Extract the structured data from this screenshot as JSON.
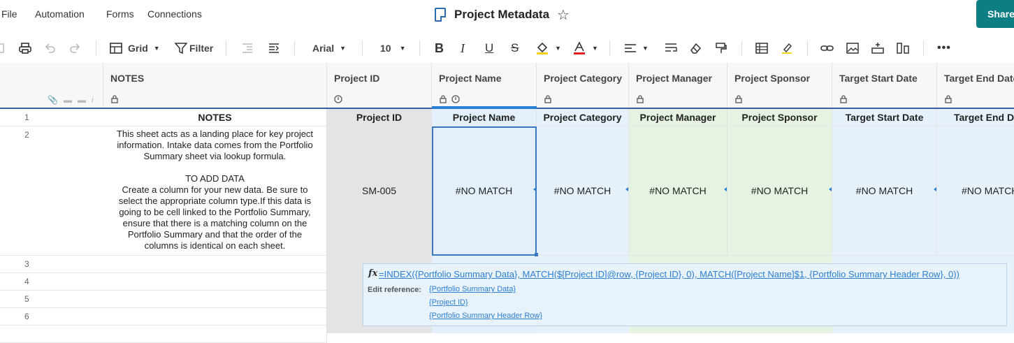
{
  "menu": {
    "items": [
      "File",
      "Automation",
      "Forms",
      "Connections"
    ],
    "title": "Project Metadata",
    "share_label": "Share"
  },
  "toolbar": {
    "view_label": "Grid",
    "filter_label": "Filter",
    "font_name": "Arial",
    "font_size": "10"
  },
  "columns": {
    "notes": "NOTES",
    "project_id": "Project ID",
    "project_name": "Project Name",
    "project_category": "Project Category",
    "project_manager": "Project Manager",
    "project_sponsor": "Project Sponsor",
    "target_start": "Target Start Date",
    "target_end": "Target End Date"
  },
  "rows": {
    "numbers": [
      "1",
      "2",
      "3",
      "4",
      "5",
      "6"
    ],
    "row1": {
      "notes": "NOTES",
      "project_id": "Project ID",
      "project_name": "Project Name",
      "project_category": "Project Category",
      "project_manager": "Project Manager",
      "project_sponsor": "Project Sponsor",
      "target_start": "Target Start Date",
      "target_end": "Target End Da"
    },
    "row2": {
      "notes": "This sheet acts as a landing place for key project information. Intake data comes from the Portfolio Summary sheet via lookup formula.\n\nTO ADD DATA\nCreate a column for your new data. Be sure to select the appropriate column type.If this data is going to be cell linked to the Portfolio Summary, ensure that there is a matching column on the Portfolio Summary and that the order of the columns is identical on each sheet.",
      "project_id": "SM-005",
      "project_name": "#NO MATCH",
      "project_category": "#NO MATCH",
      "project_manager": "#NO MATCH",
      "project_sponsor": "#NO MATCH",
      "target_start": "#NO MATCH",
      "target_end": "#NO MATCH"
    }
  },
  "formula_popup": {
    "formula": "=INDEX({Portfolio Summary Data}, MATCH($[Project ID]@row, {Project ID}, 0), MATCH([Project Name]$1, {Portfolio Summary Header Row}, 0))",
    "edit_reference_label": "Edit reference:",
    "references": [
      "{Portfolio Summary Data}",
      "{Project ID}",
      "{Portfolio Summary Header Row}"
    ]
  },
  "colors": {
    "accent": "#0d7e83",
    "link": "#2b7fd3",
    "blue_column": "#e3effb",
    "green_column": "#e6f3e3",
    "locked_column": "#e4e4e4"
  }
}
